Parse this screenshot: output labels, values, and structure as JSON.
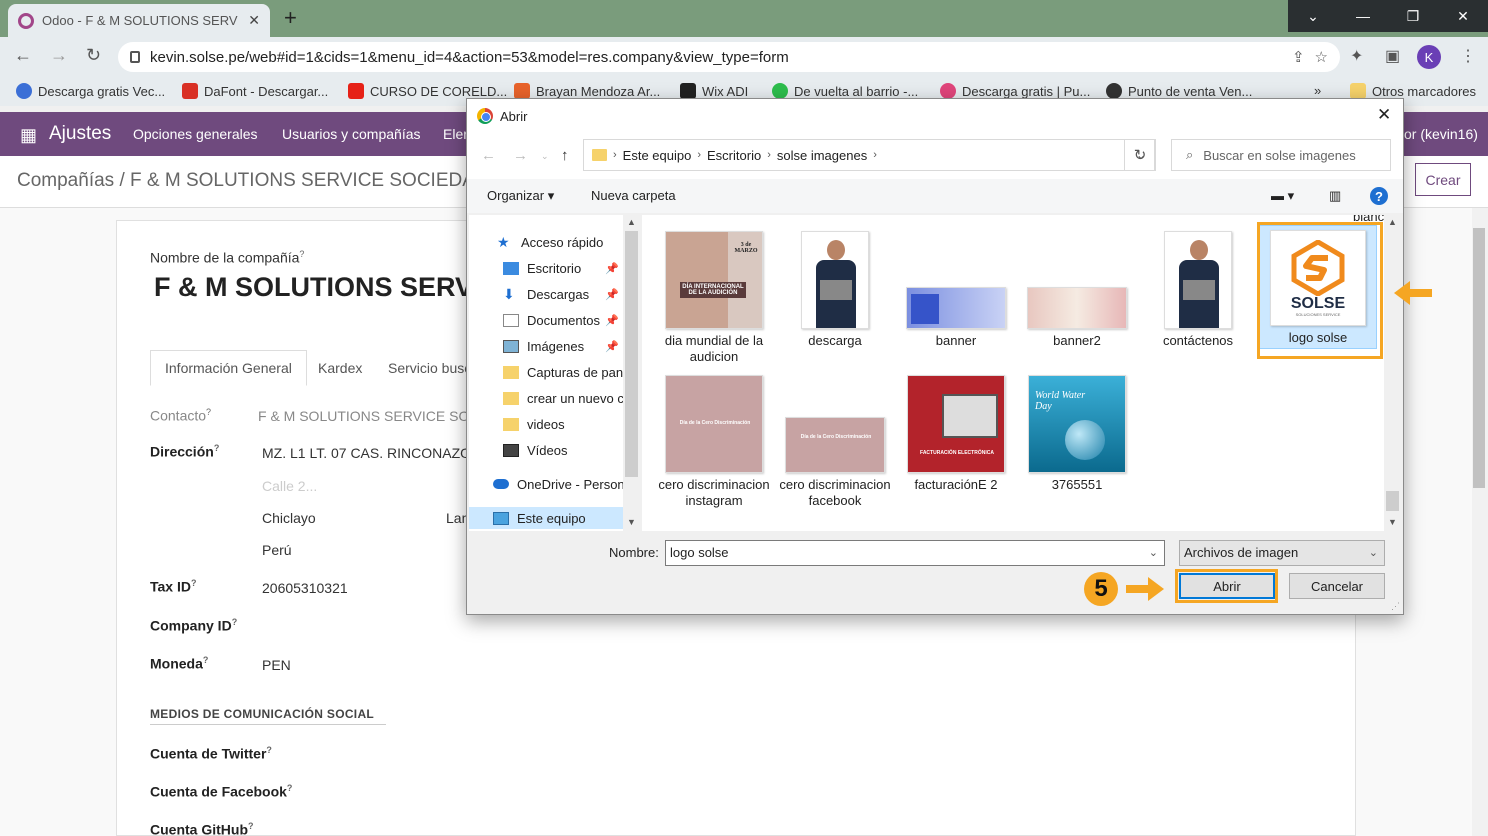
{
  "browser": {
    "tab_title": "Odoo - F & M SOLUTIONS SERV",
    "url": "kevin.solse.pe/web#id=1&cids=1&menu_id=4&action=53&model=res.company&view_type=form",
    "avatar_letter": "K",
    "bookmarks": [
      {
        "label": "Descarga gratis Vec...",
        "color": "#3b6fd6"
      },
      {
        "label": "DaFont - Descargar...",
        "color": "#d93025"
      },
      {
        "label": "CURSO DE CORELD...",
        "color": "#e62117"
      },
      {
        "label": "Brayan Mendoza Ar...",
        "color": "#e8632b"
      },
      {
        "label": "Wix ADI",
        "color": "#222222"
      },
      {
        "label": "De vuelta al barrio -...",
        "color": "#2dbd4c"
      },
      {
        "label": "Descarga gratis | Pu...",
        "color": "#e0457b"
      },
      {
        "label": "Punto de venta Ven...",
        "color": "#333333"
      }
    ],
    "more_bookmarks": "»",
    "other_bookmarks": "Otros marcadores"
  },
  "odoo": {
    "app": "Ajustes",
    "menu": [
      "Opciones generales",
      "Usuarios y compañías",
      "Eler"
    ],
    "user": "or (kevin16)",
    "breadcrumb": "Compañías / F & M SOLUTIONS SERVICE SOCIEDAD",
    "create": "Crear",
    "form": {
      "name_label": "Nombre de la compañía",
      "name_value": "F & M SOLUTIONS SERV",
      "tabs": [
        "Información General",
        "Kardex",
        "Servicio busc"
      ],
      "contact_label": "Contacto",
      "contact_value": "F & M SOLUTIONS SERVICE SOCI",
      "address_label": "Dirección",
      "street": "MZ. L1 LT. 07 CAS. RINCONAZO",
      "street2_placeholder": "Calle 2...",
      "city": "Chiclayo",
      "state": "Lam",
      "country": "Perú",
      "taxid_label": "Tax ID",
      "taxid_value": "20605310321",
      "companyid_label": "Company ID",
      "currency_label": "Moneda",
      "currency_value": "PEN",
      "social_section": "MEDIOS DE COMUNICACIÓN SOCIAL",
      "twitter_label": "Cuenta de Twitter",
      "facebook_label": "Cuenta de Facebook",
      "github_label": "Cuenta GitHub"
    }
  },
  "dialog": {
    "title": "Abrir",
    "path": [
      "Este equipo",
      "Escritorio",
      "solse imagenes"
    ],
    "search_placeholder": "Buscar en solse imagenes",
    "organize": "Organizar",
    "new_folder": "Nueva carpeta",
    "tree": [
      {
        "label": "Acceso rápido",
        "icon": "star-icon",
        "pinned": false
      },
      {
        "label": "Escritorio",
        "icon": "desktop-icon",
        "pinned": true
      },
      {
        "label": "Descargas",
        "icon": "download-icon",
        "pinned": true
      },
      {
        "label": "Documentos",
        "icon": "documents-icon",
        "pinned": true
      },
      {
        "label": "Imágenes",
        "icon": "pictures-icon",
        "pinned": true
      },
      {
        "label": "Capturas de pant",
        "icon": "folder-icon",
        "pinned": false
      },
      {
        "label": "crear un nuevo c",
        "icon": "folder-icon",
        "pinned": false
      },
      {
        "label": "videos",
        "icon": "folder-icon",
        "pinned": false
      },
      {
        "label": "Vídeos",
        "icon": "videos-icon",
        "pinned": false
      },
      {
        "label": "OneDrive - Person",
        "icon": "cloud-icon",
        "pinned": false
      },
      {
        "label": "Este equipo",
        "icon": "computer-icon",
        "pinned": false
      }
    ],
    "partial_top_label": "blancas",
    "files": [
      {
        "label": "dia mundial de la audicion",
        "thumb": "audicion"
      },
      {
        "label": "descarga",
        "thumb": "man"
      },
      {
        "label": "banner",
        "thumb": "banner"
      },
      {
        "label": "banner2",
        "thumb": "banner2"
      },
      {
        "label": "contáctenos",
        "thumb": "man"
      },
      {
        "label": "logo solse",
        "thumb": "logo"
      },
      {
        "label": "cero discriminacion instagram",
        "thumb": "hands"
      },
      {
        "label": "cero discriminacion facebook",
        "thumb": "hands-wide"
      },
      {
        "label": "facturaciónE 2",
        "thumb": "factura"
      },
      {
        "label": "3765551",
        "thumb": "water"
      }
    ],
    "thumb_text": {
      "audicion_date": "3 de MARZO",
      "audicion_title": "DÍA INTERNACIONAL DE LA AUDICIÓN",
      "logo_word": "SOLSE",
      "logo_sub": "SOLUCIONES SERVICE",
      "hands_caption": "Día de la Cero Discriminación",
      "factura_caption": "FACTURACIÓN ELECTRÓNICA",
      "water_caption": "World Water Day"
    },
    "name_label": "Nombre:",
    "name_value": "logo solse",
    "file_type": "Archivos de imagen",
    "open": "Abrir",
    "cancel": "Cancelar"
  },
  "annotation": {
    "step": "5",
    "color": "#f5a623"
  }
}
